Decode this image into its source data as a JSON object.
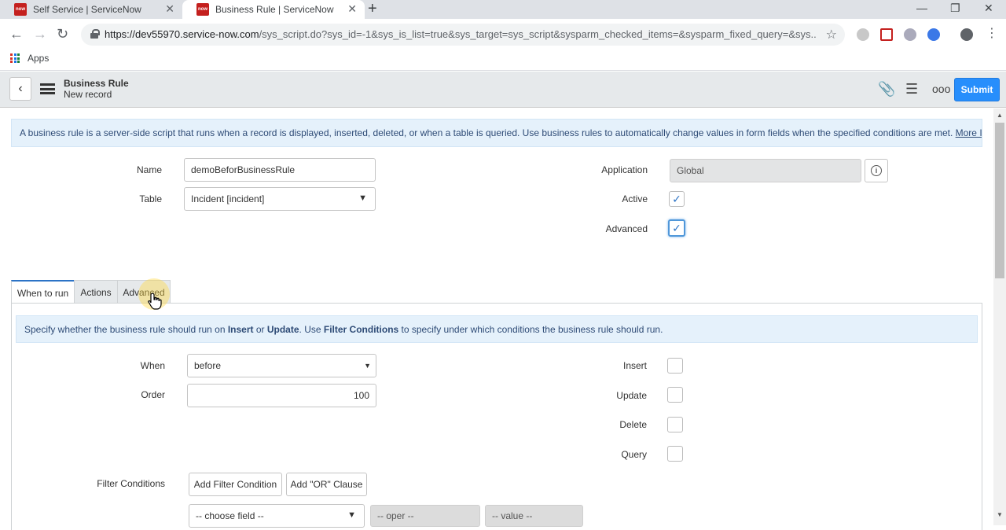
{
  "browser": {
    "tabs": [
      {
        "label": "Self Service | ServiceNow",
        "favicon": "now"
      },
      {
        "label": "Business Rule | ServiceNow",
        "favicon": "now"
      }
    ],
    "url_host": "https://dev55970.service-now.com",
    "url_path": "/sys_script.do?sys_id=-1&sys_is_list=true&sys_target=sys_script&sysparm_checked_items=&sysparm_fixed_query=&sys...",
    "bookmarks": {
      "apps_label": "Apps"
    }
  },
  "header": {
    "title": "Business Rule",
    "subtitle": "New record",
    "submit_label": "Submit"
  },
  "info": {
    "text": "A business rule is a server-side script that runs when a record is displayed, inserted, deleted, or when a table is queried. Use business rules to automatically change values in form fields when the specified conditions are met.",
    "more_info": "More Info"
  },
  "form": {
    "name_label": "Name",
    "name_value": "demoBeforBusinessRule",
    "table_label": "Table",
    "table_value": "Incident [incident]",
    "application_label": "Application",
    "application_value": "Global",
    "active_label": "Active",
    "active_checked": true,
    "advanced_label": "Advanced",
    "advanced_checked": true
  },
  "tabs": [
    {
      "label": "When to run",
      "selected": true
    },
    {
      "label": "Actions",
      "selected": false
    },
    {
      "label": "Advanced",
      "selected": false
    }
  ],
  "when_to_run": {
    "hint_pre": "Specify whether the business rule should run on ",
    "hint_insert": "Insert",
    "hint_or": " or ",
    "hint_update": "Update",
    "hint_mid": ". Use ",
    "hint_filter": "Filter Conditions",
    "hint_post": " to specify under which conditions the business rule should run.",
    "when_label": "When",
    "when_value": "before",
    "order_label": "Order",
    "order_value": "100",
    "insert_label": "Insert",
    "update_label": "Update",
    "delete_label": "Delete",
    "query_label": "Query",
    "filter_label": "Filter Conditions",
    "add_filter_label": "Add Filter Condition",
    "add_or_label": "Add \"OR\" Clause",
    "choose_field": "-- choose field --",
    "oper": "-- oper --",
    "value": "-- value --"
  }
}
